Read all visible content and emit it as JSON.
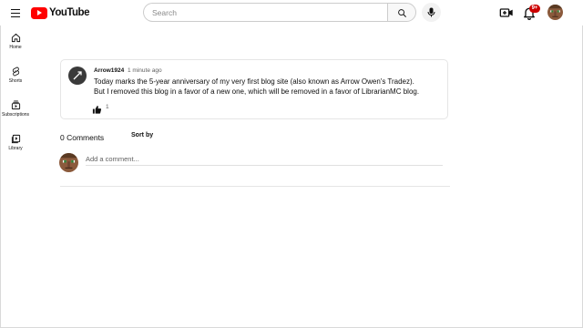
{
  "app": {
    "logo_text": "YouTube"
  },
  "search": {
    "placeholder": "Search",
    "value": ""
  },
  "notifications": {
    "badge": "9+"
  },
  "sidebar": {
    "items": [
      {
        "label": "Home",
        "icon": "home-icon"
      },
      {
        "label": "Shorts",
        "icon": "shorts-icon"
      },
      {
        "label": "Subscriptions",
        "icon": "subscriptions-icon"
      },
      {
        "label": "Library",
        "icon": "library-icon"
      }
    ]
  },
  "post": {
    "author": "Arrow1924",
    "time": "1 minute ago",
    "lines": [
      "Today marks the 5-year anniversary of my very first blog site (also known as Arrow Owen's Tradez).",
      "But I removed this blog in a favor of a new one, which will be removed in a favor of LibrarianMC blog."
    ],
    "likes": "1"
  },
  "comments": {
    "count_label": "0 Comments",
    "sort_label": "Sort by",
    "add_placeholder": "Add a comment..."
  },
  "colors": {
    "brand": "#ff0000",
    "badge": "#cc0000",
    "text": "#0f0f0f",
    "muted": "#606060"
  }
}
